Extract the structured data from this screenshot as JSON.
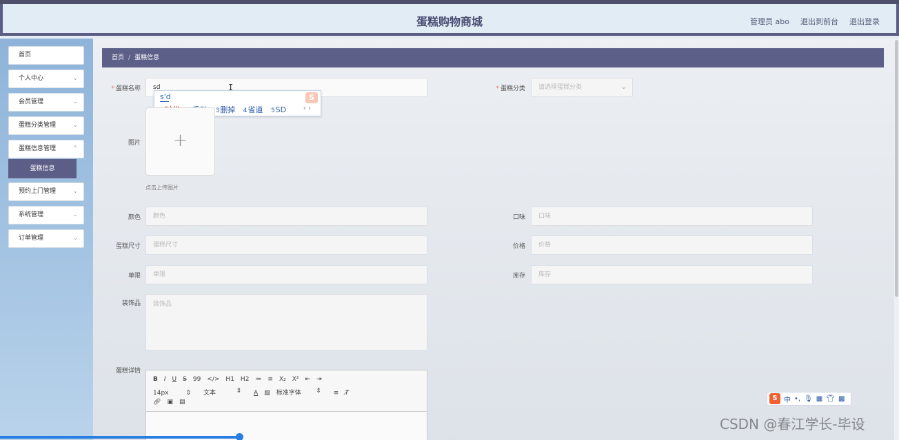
{
  "header": {
    "title": "蛋糕购物商城",
    "user": "管理员 abo",
    "to_front": "退出到前台",
    "logout": "退出登录"
  },
  "sidebar": {
    "items": [
      {
        "label": "首页"
      },
      {
        "label": "个人中心"
      },
      {
        "label": "会员管理"
      },
      {
        "label": "蛋糕分类管理"
      },
      {
        "label": "蛋糕信息管理"
      },
      {
        "label": "预约上门管理"
      },
      {
        "label": "系统管理"
      },
      {
        "label": "订单管理"
      }
    ],
    "active_sub": "蛋糕信息"
  },
  "breadcrumb": {
    "home": "首页",
    "sep": "/",
    "current": "蛋糕信息"
  },
  "form": {
    "name": {
      "label": "蛋糕名称",
      "value": "sd"
    },
    "category": {
      "label": "蛋糕分类",
      "placeholder": "请选择蛋糕分类"
    },
    "image": {
      "label": "图片",
      "hint": "点击上传图片"
    },
    "color": {
      "label": "颜色",
      "placeholder": "颜色"
    },
    "flavor": {
      "label": "口味",
      "placeholder": "口味"
    },
    "size": {
      "label": "蛋糕尺寸",
      "placeholder": "蛋糕尺寸"
    },
    "price": {
      "label": "价格",
      "placeholder": "价格"
    },
    "limit": {
      "label": "单限",
      "placeholder": "单限"
    },
    "stock": {
      "label": "库存",
      "placeholder": "库存"
    },
    "decoration": {
      "label": "装饰品",
      "placeholder": "装饰品"
    },
    "detail": {
      "label": "蛋糕详情"
    }
  },
  "ime": {
    "composition": "s'd",
    "candidates": [
      {
        "n": "1",
        "text": "时代"
      },
      {
        "n": "2",
        "text": "手动"
      },
      {
        "n": "3",
        "text": "删掉"
      },
      {
        "n": "4",
        "text": "省道"
      },
      {
        "n": "5",
        "text": "SD"
      }
    ]
  },
  "editor": {
    "row1": [
      "B",
      "I",
      "U",
      "S",
      "99",
      "</>",
      "H1",
      "H2",
      "≔",
      "≡",
      "X₂",
      "X²",
      "⇤",
      "⇥"
    ],
    "font_size": "14px",
    "text_type": "文本",
    "font_family": "标准字体"
  },
  "watermark": "CSDN @春江学长-毕设"
}
